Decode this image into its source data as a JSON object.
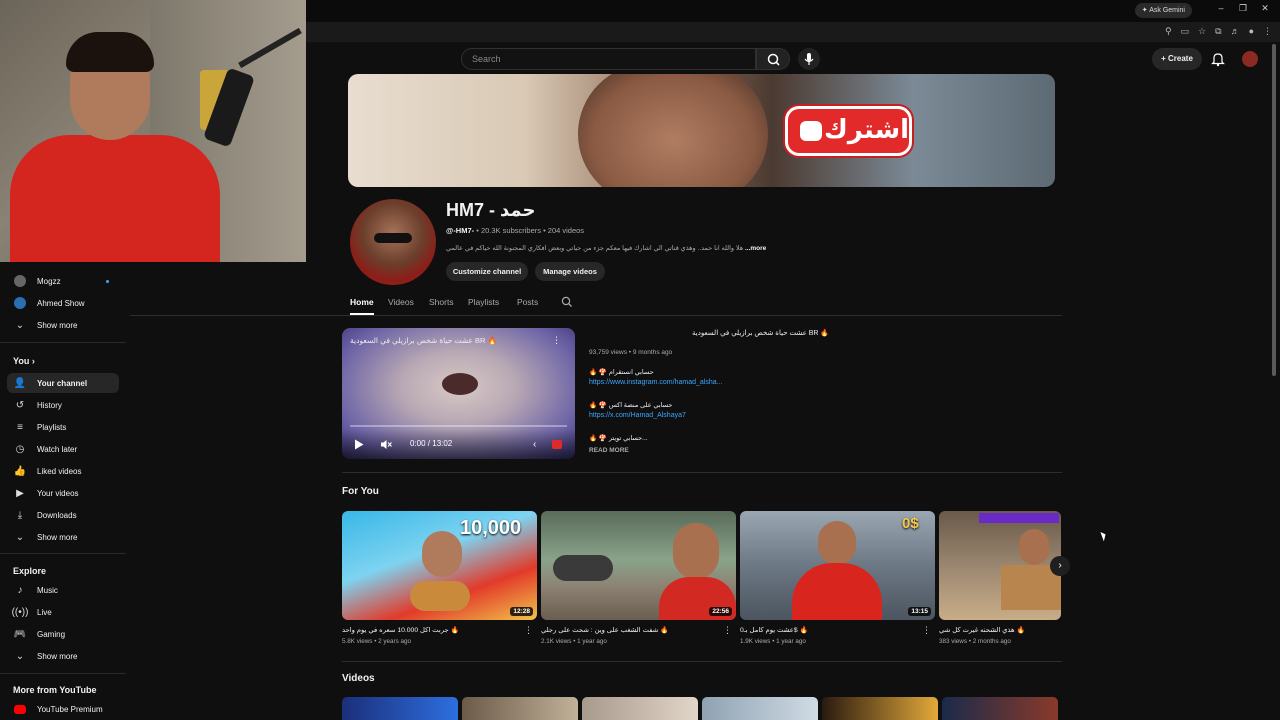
{
  "browser": {
    "gemini_label": "Ask Gemini"
  },
  "header": {
    "search_placeholder": "Search",
    "create_label": "Create"
  },
  "sidebar": {
    "subs": [
      {
        "label": "Mogzz"
      },
      {
        "label": "Ahmed Show"
      },
      {
        "label": "Show more"
      }
    ],
    "you_heading": "You",
    "you_items": [
      {
        "label": "Your channel",
        "icon": "person-icon"
      },
      {
        "label": "History",
        "icon": "history-icon"
      },
      {
        "label": "Playlists",
        "icon": "playlist-icon"
      },
      {
        "label": "Watch later",
        "icon": "clock-icon"
      },
      {
        "label": "Liked videos",
        "icon": "thumb-up-icon"
      },
      {
        "label": "Your videos",
        "icon": "video-icon"
      },
      {
        "label": "Downloads",
        "icon": "download-icon"
      },
      {
        "label": "Show more",
        "icon": "chevron-down-icon"
      }
    ],
    "explore_heading": "Explore",
    "explore_items": [
      {
        "label": "Music",
        "icon": "music-icon"
      },
      {
        "label": "Live",
        "icon": "live-icon"
      },
      {
        "label": "Gaming",
        "icon": "gaming-icon"
      },
      {
        "label": "Show more",
        "icon": "chevron-down-icon"
      }
    ],
    "more_heading": "More from YouTube",
    "more_items": [
      {
        "label": "YouTube Premium",
        "icon": "youtube-icon"
      }
    ]
  },
  "banner": {
    "subscribe_text": "اشترك"
  },
  "channel": {
    "name": "HM7 - حمد",
    "handle": "@-HM7-",
    "stats": "• 20.3K subscribers • 204 videos",
    "description": "هلا والله انا حمد.. وهذي قناتي الي اشارك فيها معكم جزء من حياتي وبعض افكاري المجنونة الله حياكم في عالمي",
    "more": "...more",
    "customize_label": "Customize channel",
    "manage_label": "Manage videos"
  },
  "tabs": [
    "Home",
    "Videos",
    "Shorts",
    "Playlists",
    "Posts"
  ],
  "featured": {
    "overlay_title": "عشت حياة شخص برازيلي في السعودية BR 🔥",
    "time": "0:00 / 13:02",
    "title": "عشت حياة شخص برازيلي في السعودية BR 🔥",
    "views": "93,759 views • 9 months ago",
    "lines": [
      {
        "text": "🔥 🍄 حسابي انستقرام",
        "link": "https://www.instagram.com/hamad_alsha..."
      },
      {
        "text": "🔥 🍄 حسابي على منصة اكس",
        "link": "https://x.com/Hamad_Alshaya7"
      },
      {
        "text": "🔥 🍄 حسابي تويتر...",
        "link": ""
      }
    ],
    "read_more": "READ MORE"
  },
  "for_you": {
    "title": "For You",
    "cards": [
      {
        "title": "جربت اكل 10.000 سعره في يوم واحد 🔥",
        "meta": "5.8K views • 2 years ago",
        "duration": "12:28",
        "label": "10,000"
      },
      {
        "title": "شفت الشغب على وين : شحت على رجلي 🔥",
        "meta": "2.1K views • 1 year ago",
        "duration": "22:56",
        "label": ""
      },
      {
        "title": "عشت يوم كامل بـ0$ 🔥",
        "meta": "1.9K views • 1 year ago",
        "duration": "13:15",
        "label": "0$"
      },
      {
        "title": "هذي الشحنه غيرت كل شي 🔥",
        "meta": "383 views • 2 months ago",
        "duration": "",
        "label": ""
      }
    ]
  },
  "videos": {
    "title": "Videos"
  }
}
